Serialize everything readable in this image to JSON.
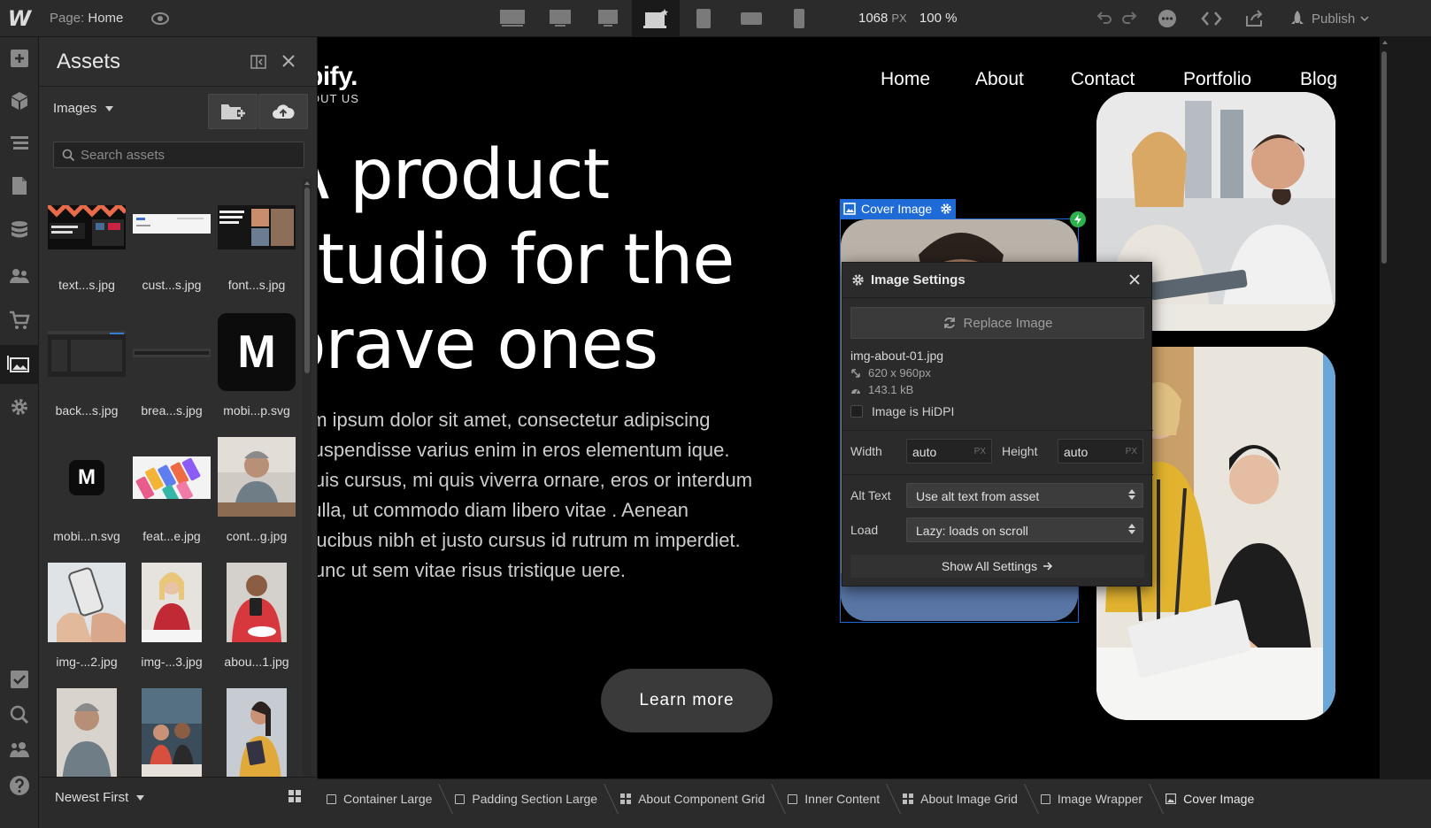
{
  "topbar": {
    "logo": "W",
    "page_key": "Page:",
    "page_name": "Home",
    "width_value": "1068",
    "width_unit": "PX",
    "zoom": "100 %",
    "publish_label": "Publish",
    "breakpoints": [
      "desktop-xxl-icon",
      "desktop-xl-icon",
      "desktop-large-icon",
      "desktop-base-icon",
      "tablet-icon",
      "mobile-landscape-icon",
      "mobile-portrait-icon"
    ]
  },
  "rail": {
    "icons": [
      "add-panel-icon",
      "components-icon",
      "navigator-icon",
      "pages-icon",
      "cms-icon",
      "users-icon",
      "ecommerce-icon",
      "assets-icon",
      "settings-icon",
      "audit-icon",
      "search-icon",
      "collaborators-icon",
      "help-icon"
    ],
    "active": "assets-icon"
  },
  "assets": {
    "title": "Assets",
    "filter_label": "Images",
    "search_placeholder": "Search assets",
    "sort_label": "Newest First",
    "items": [
      {
        "name": "text...s.jpg"
      },
      {
        "name": "cust...s.jpg"
      },
      {
        "name": "font...s.jpg"
      },
      {
        "name": "back...s.jpg"
      },
      {
        "name": "brea...s.jpg"
      },
      {
        "name": "mobi...p.svg",
        "glyph": "M"
      },
      {
        "name": "mobi...n.svg",
        "glyph": "M"
      },
      {
        "name": "feat...e.jpg"
      },
      {
        "name": "cont...g.jpg"
      },
      {
        "name": "img-...2.jpg"
      },
      {
        "name": "img-...3.jpg"
      },
      {
        "name": "abou...1.jpg"
      },
      {
        "name": ""
      },
      {
        "name": ""
      },
      {
        "name": ""
      }
    ]
  },
  "site": {
    "brand": "bify.",
    "brand_sub": "OUT US",
    "nav": [
      "Home",
      "About",
      "Contact",
      "Portfolio",
      "Blog"
    ],
    "hero": "A product\nstudio for the\nbrave ones",
    "paragraph": "em ipsum dolor sit amet, consectetur adipiscing Suspendisse varius enim in eros elementum ique. Duis cursus, mi quis viverra ornare, eros or interdum nulla, ut commodo diam libero vitae . Aenean faucibus nibh et justo cursus id rutrum m imperdiet. Nunc ut sem vitae risus tristique uere.",
    "cta": "Learn more"
  },
  "selection": {
    "label": "Cover Image"
  },
  "image_settings": {
    "title": "Image Settings",
    "replace_label": "Replace Image",
    "file_name": "img-about-01.jpg",
    "dimensions": "620 x 960px",
    "size": "143.1 kB",
    "hidpi_label": "Image is HiDPI",
    "hidpi_checked": false,
    "width_label": "Width",
    "width_value": "auto",
    "height_label": "Height",
    "height_value": "auto",
    "unit": "PX",
    "alt_label": "Alt Text",
    "alt_value": "Use alt text from asset",
    "load_label": "Load",
    "load_value": "Lazy: loads on scroll",
    "show_all_label": "Show All Settings"
  },
  "breadcrumbs": [
    {
      "label": "Container Large",
      "icon": "box-icon"
    },
    {
      "label": "Padding Section Large",
      "icon": "box-icon"
    },
    {
      "label": "About Component Grid",
      "icon": "grid-icon"
    },
    {
      "label": "Inner Content",
      "icon": "box-icon"
    },
    {
      "label": "About Image Grid",
      "icon": "grid-icon"
    },
    {
      "label": "Image Wrapper",
      "icon": "box-icon"
    },
    {
      "label": "Cover Image",
      "icon": "image-icon"
    }
  ],
  "colors": {
    "selection_blue": "#1e6ad7",
    "bolt_green": "#2bb24c"
  }
}
